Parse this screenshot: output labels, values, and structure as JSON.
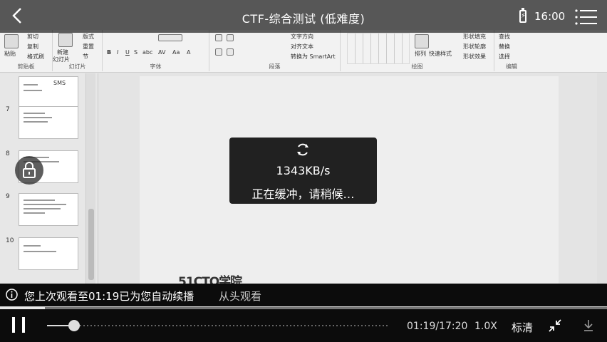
{
  "header": {
    "title": "CTF-综合测试 (低难度)",
    "battery_symbol": "⚡",
    "clock": "16:00"
  },
  "ribbon": {
    "groups": [
      {
        "title": "剪贴板",
        "items": [
          "粘贴",
          "剪切",
          "复制",
          "格式刷"
        ]
      },
      {
        "title": "幻灯片",
        "items": [
          "新建",
          "幻灯片",
          "版式",
          "重置",
          "节"
        ]
      },
      {
        "title": "字体",
        "items": [
          "B",
          "I",
          "U",
          "S",
          "abc",
          "AV",
          "Aa",
          "A"
        ]
      },
      {
        "title": "段落",
        "items": [
          "文字方向",
          "对齐文本",
          "转换为 SmartArt"
        ]
      },
      {
        "title": "绘图",
        "items": [
          "排列",
          "快速样式",
          "形状填充",
          "形状轮廓",
          "形状效果"
        ]
      },
      {
        "title": "编辑",
        "items": [
          "查找",
          "替换",
          "选择"
        ]
      }
    ]
  },
  "thumbnails": [
    {
      "number": "",
      "label": "SMS"
    },
    {
      "number": "7",
      "label": ""
    },
    {
      "number": "8",
      "label": ""
    },
    {
      "number": "9",
      "label": ""
    },
    {
      "number": "10",
      "label": ""
    }
  ],
  "slide": {
    "logo_text": "51CTO学院"
  },
  "buffering": {
    "speed": "1343KB/s",
    "message": "正在缓冲，请稍候…"
  },
  "notice": {
    "prefix": "您上次观看至",
    "time": "01:19",
    "suffix": "已为您自动续播",
    "restart_label": "从头观看"
  },
  "player": {
    "progress_fraction": 0.0735,
    "volume_fraction": 0.08,
    "current_time": "01:19",
    "total_time": "17:20",
    "separator": "/",
    "speed": "1.0X",
    "quality": "标清"
  },
  "icons": {
    "back": "chevron-left-icon",
    "menu": "menu-icon",
    "spinner": "refresh-spinner-icon",
    "lock": "lock-icon",
    "info": "info-icon",
    "pause": "pause-icon",
    "shrink": "exit-fullscreen-icon",
    "download": "download-icon"
  }
}
